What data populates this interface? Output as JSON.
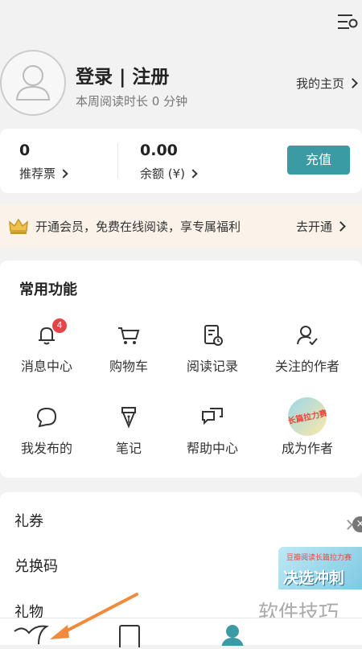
{
  "header": {
    "settings_icon": "settings-icon"
  },
  "profile": {
    "title": "登录 | 注册",
    "subtitle": "本周阅读时长 0 分钟",
    "home_link": "我的主页"
  },
  "wallet": {
    "votes_value": "0",
    "votes_label": "推荐票",
    "balance_value": "0.00",
    "balance_label": "余额 (¥)",
    "recharge": "充值"
  },
  "vip": {
    "text": "开通会员，免费在线阅读，享专属福利",
    "action": "去开通"
  },
  "functions": {
    "title": "常用功能",
    "items": [
      {
        "label": "消息中心",
        "icon": "bell-icon",
        "badge": "4"
      },
      {
        "label": "购物车",
        "icon": "cart-icon"
      },
      {
        "label": "阅读记录",
        "icon": "reading-history-icon"
      },
      {
        "label": "关注的作者",
        "icon": "follow-author-icon"
      },
      {
        "label": "我发布的",
        "icon": "chat-bubble-icon"
      },
      {
        "label": "笔记",
        "icon": "pen-nib-icon"
      },
      {
        "label": "帮助中心",
        "icon": "help-chat-icon"
      },
      {
        "label": "成为作者",
        "icon": "become-author-badge-icon",
        "badge_text": "长篇拉力赛"
      }
    ]
  },
  "menu": {
    "items": [
      "礼券",
      "兑换码",
      "礼物"
    ]
  },
  "promo": {
    "top": "豆瓣阅读长篇拉力赛",
    "main": "决选冲刺"
  },
  "watermark": "软件技巧",
  "tabbar": {
    "icons": [
      "bird-icon",
      "bookshelf-icon",
      "profile-icon"
    ]
  },
  "colors": {
    "accent": "#3a9ba5",
    "badge": "#e54545",
    "vip_bg": "#fbf3ea"
  }
}
